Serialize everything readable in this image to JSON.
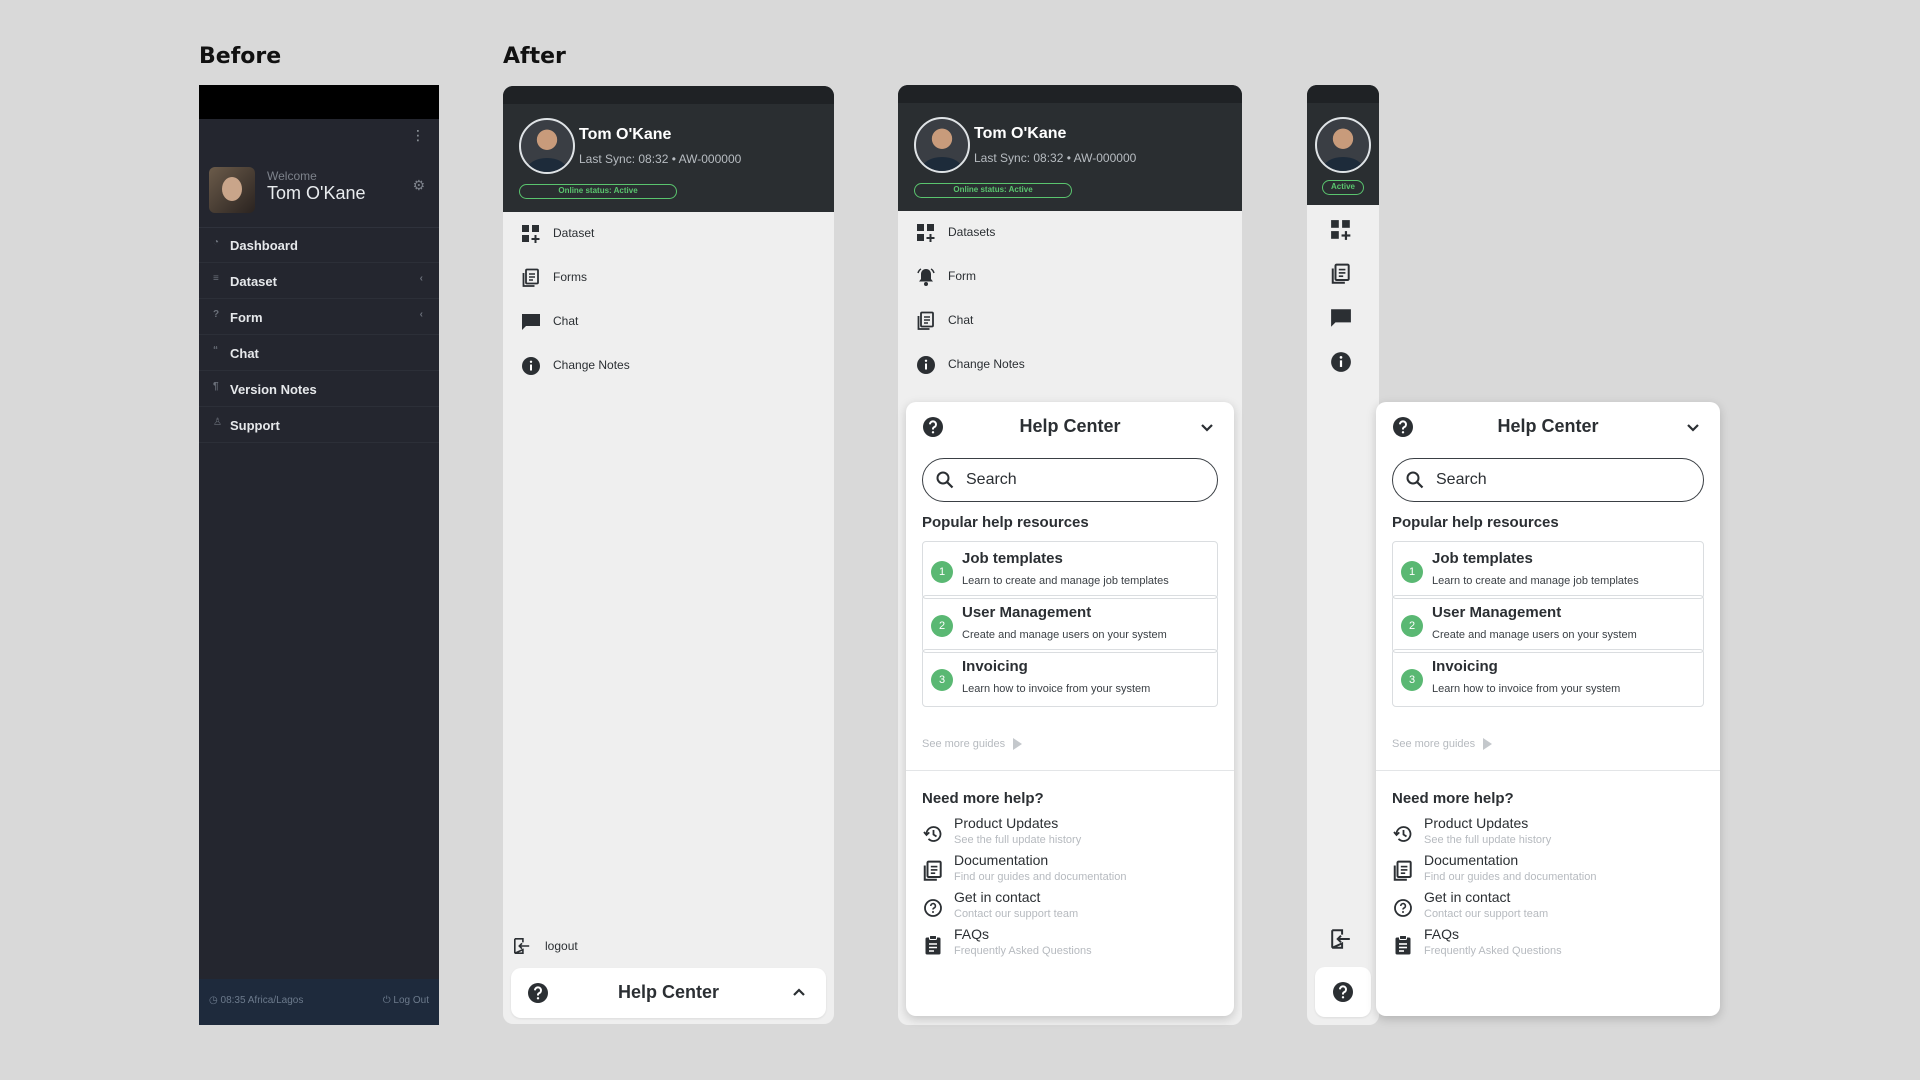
{
  "labels": {
    "before": "Before",
    "after": "After"
  },
  "before": {
    "welcome": "Welcome",
    "user_name": "Tom O'Kane",
    "menu": [
      {
        "label": "Dashboard",
        "icon": "dashboard-icon",
        "has_chevron": false
      },
      {
        "label": "Dataset",
        "icon": "database-icon",
        "has_chevron": true
      },
      {
        "label": "Form",
        "icon": "question-icon",
        "has_chevron": true
      },
      {
        "label": "Chat",
        "icon": "quote-icon",
        "has_chevron": false
      },
      {
        "label": "Version Notes",
        "icon": "paragraph-icon",
        "has_chevron": false
      },
      {
        "label": "Support",
        "icon": "support-icon",
        "has_chevron": false
      }
    ],
    "footer_time": "08:35 Africa/Lagos",
    "footer_logout": "Log Out"
  },
  "after1": {
    "user_name": "Tom O'Kane",
    "sync": "Last Sync: 08:32  •  AW-000000",
    "status": "Online status: Active",
    "menu": [
      "Dataset",
      "Forms",
      "Chat",
      "Change Notes"
    ],
    "logout": "logout",
    "help_center": "Help Center"
  },
  "after2": {
    "user_name": "Tom O'Kane",
    "sync": "Last Sync: 08:32  •  AW-000000",
    "status": "Online status: Active",
    "menu": [
      "Datasets",
      "Form",
      "Chat",
      "Change Notes"
    ]
  },
  "narrow": {
    "status": "Active"
  },
  "help": {
    "title": "Help Center",
    "search_placeholder": "Search",
    "popular_heading": "Popular help resources",
    "cards": [
      {
        "num": "1",
        "title": "Job templates",
        "desc": "Learn to create and manage job templates"
      },
      {
        "num": "2",
        "title": "User Management",
        "desc": "Create and manage users on your system"
      },
      {
        "num": "3",
        "title": "Invoicing",
        "desc": "Learn how to invoice from your system"
      }
    ],
    "see_more": "See more guides",
    "need_heading": "Need more help?",
    "resources": [
      {
        "title": "Product Updates",
        "desc": "See the full update history",
        "icon": "history-icon"
      },
      {
        "title": "Documentation",
        "desc": "Find our guides and documentation",
        "icon": "docs-icon"
      },
      {
        "title": "Get in contact",
        "desc": "Contact our support team",
        "icon": "help-circle-icon"
      },
      {
        "title": "FAQs",
        "desc": "Frequently Asked Questions",
        "icon": "clipboard-icon"
      }
    ]
  },
  "colors": {
    "accent_green": "#5ab873",
    "header_dark": "#2a2e31",
    "before_bg": "#24262f"
  }
}
